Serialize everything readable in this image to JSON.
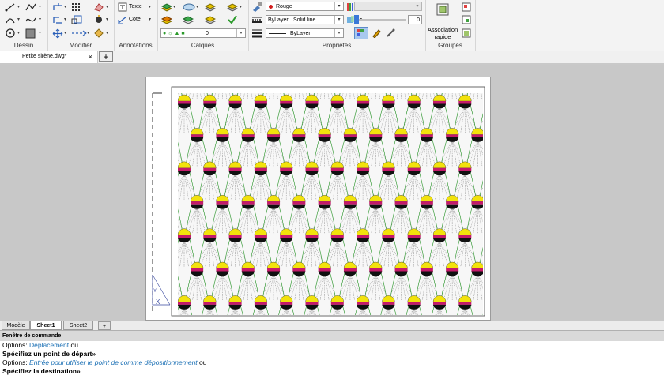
{
  "ribbon": {
    "panels": {
      "dessin": "Dessin",
      "modifier": "Modifier",
      "annotations": "Annotations",
      "calques": "Calques",
      "proprietes": "Propriétés",
      "groupes": "Groupes"
    },
    "annotations": {
      "texte": "Texte",
      "cote": "Cote"
    },
    "calques": {
      "layer_value": "0"
    },
    "proprietes": {
      "color": "Rouge",
      "color_hex": "#d11b1b",
      "linetype_layer": "ByLayer",
      "linetype_value": "Solid line",
      "lineweight": "ByLayer",
      "transparency": "0"
    },
    "groupes": {
      "association_line1": "Association",
      "association_line2": "rapide"
    }
  },
  "doc_tabs": {
    "active": "Petite sirène.dwg*",
    "close": "×",
    "new": "+"
  },
  "layout_tabs": {
    "items": [
      "Modèle",
      "Sheet1",
      "Sheet2"
    ],
    "active": "Sheet1",
    "add": "+"
  },
  "ucs": {
    "x_label": "X",
    "y_label": "Y"
  },
  "command": {
    "title": "Fenêtre de commande",
    "l1_a": "Options: ",
    "l1_b": "Déplacement",
    "l1_c": " ou",
    "l2": "Spécifiez un point de départ»",
    "l3_a": "Options: ",
    "l3_b": "Entrée pour utiliser le point de comme dépositionnement",
    "l3_c": " ou",
    "l4": "Spécifiez la destination»"
  },
  "pattern_colors": {
    "yellow": "#f2e20c",
    "pink": "#c41a6a",
    "black": "#101010",
    "green": "#1f8f1f"
  }
}
